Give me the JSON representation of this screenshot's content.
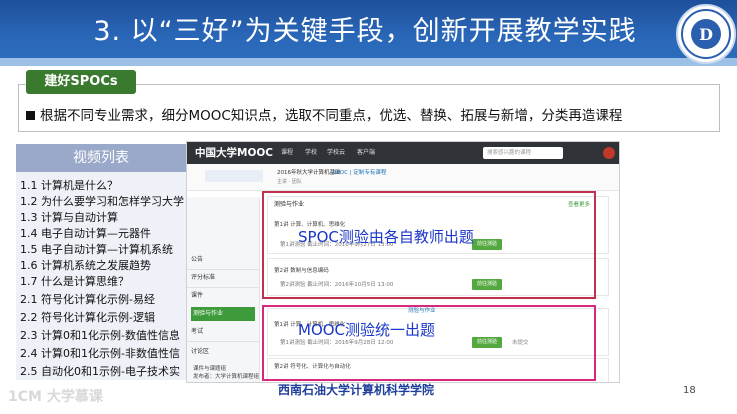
{
  "slide": {
    "title": "3. 以“三好”为关键手段，创新开展教学实践",
    "section_tab": "建好SPOCs",
    "bullet_text": "根据不同专业需求，细分MOOC知识点，选取不同重点，优选、替换、拓展与新增，分类再造课程",
    "footer": "西南石油大学计算机科学学院",
    "page_number": "18",
    "watermark": "1CM 大学慕课",
    "colors": {
      "header": "#2a67b8",
      "tab": "#3a7a2e",
      "callout1": "#c3304e",
      "callout2": "#d6287f",
      "callout_text": "#1a36c9"
    }
  },
  "video_list": {
    "header": "视频列表",
    "items": [
      "1.1  计算机是什么？",
      "1.2  为什么要学习和怎样学习大学",
      "1.3  计算与自动计算",
      "1.4  电子自动计算—元器件",
      "1.5  电子自动计算—计算机系统",
      "1.6  计算机系统之发展趋势",
      "1.7  什么是计算思维？",
      "2.1  符号化计算化示例-易经",
      "2.2  符号化计算化示例-逻辑",
      "2.3  计算0和1化示例-数值性信息",
      "2.4  计算0和1化示例-非数值性信",
      "2.5  自动化0和1示例-电子技术实"
    ]
  },
  "mooc": {
    "logo": "中国大学MOOC",
    "nav": [
      "课程",
      "学校",
      "学校云",
      "客户端"
    ],
    "search_placeholder": "搜索感兴趣的课程",
    "course_title": "2016年秋大学计算机基础",
    "spoc_link": "SPOC | 定制专有课程",
    "term": "主讲 · 团队",
    "side_nav": [
      "公告",
      "评分标准",
      "课件",
      "测验与作业",
      "考试",
      "讨论区"
    ],
    "card1": {
      "title": "测验与作业",
      "right_link": "查看更多",
      "line1": "第1讲 计算、计算机、思维化",
      "line2": "第1讲测验  截止时间：2016年9月27日 13:00",
      "button": "前往测验"
    },
    "card2": {
      "line1": "第2讲 数制与信息编码",
      "line2": "第2讲测验  截止时间：2016年10月5日 13:00",
      "button": "前往测验"
    },
    "card3": {
      "header": "测验与作业",
      "line1": "第1讲 计算、计算机、思维化",
      "line2": "第1讲测验  截止时间：2016年9月28日 12:00",
      "button": "前往测验",
      "status": "未提交"
    },
    "card4": {
      "line1": "第2讲 符号化、计算化与自动化"
    },
    "bottom_note1": "课件与课题组",
    "bottom_note2": "发布者：大学计算机课程组"
  },
  "callouts": {
    "spoc": "SPOC测验由各自教师出题",
    "mooc": "MOOC测验统一出题"
  }
}
